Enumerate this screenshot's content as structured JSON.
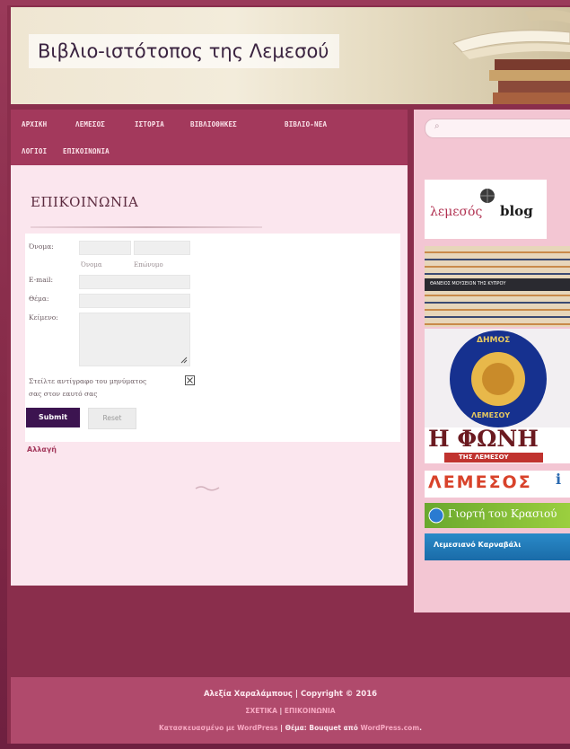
{
  "site": {
    "title": "Βιβλιο-ιστότοπος της Λεμεσού"
  },
  "nav": {
    "items": [
      "ΑΡΧΙΚΗ",
      "ΛΕΜΕΣΟΣ",
      "ΙΣΤΟΡΙΑ",
      "ΒΙΒΛΙΟΘΗΚΕΣ",
      "ΒΙΒΛΙΟ-ΝΕΑ",
      "ΛΟΓΙΟΙ",
      "ΕΠΙΚΟΙΝΩΝΙΑ"
    ]
  },
  "page": {
    "title": "ΕΠΙΚΟΙΝΩΝΙΑ"
  },
  "form": {
    "name_label": "Όνομα:",
    "first_sub": "Όνομα",
    "last_sub": "Επώνυμο",
    "email_label": "E-mail:",
    "subject_label": "Θέμα:",
    "message_label": "Κείμενο:",
    "copy_label_line1": "Στείλτε αντίγραφο του μηνύματος",
    "copy_label_line2": "σας στον εαυτό σας",
    "submit_label": "Submit",
    "reset_label": "Reset",
    "change_link": "Αλλαγή"
  },
  "sidebar": {
    "search_placeholder": "",
    "ads": [
      {
        "text": "λεμεσός",
        "text2": "blog"
      },
      {
        "text": "ΘΑΝΕΙΟΣ ΜΟΥΣΕΙΟΝ ΤΗΣ ΚΥΠΡΟΥ"
      },
      {
        "text_top": "ΔΗΜΟΣ",
        "text_bottom": "ΛΕΜΕΣΟΥ"
      },
      {
        "text": "Η ΦΩΝΗ",
        "sub": "ΤΗΣ ΛΕΜΕΣΟΥ"
      },
      {
        "text": "ΛΕΜΕΣΟΣ",
        "suffix": "i"
      },
      {
        "text": "Γιορτή του Κρασιού"
      },
      {
        "text": "Λεμεσιανό Καρναβάλι"
      }
    ]
  },
  "footer": {
    "line1": "Αλεξία Χαραλάμπους | Copyright © 2016",
    "line2_a": "ΣΧΕΤΙΚΑ",
    "line2_sep": " | ",
    "line2_b": "ΕΠΙΚΟΙΝΩΝΙΑ",
    "line3_a": "Κατασκευασμένο με WordPress",
    "line3_b": " | Θέμα: Bouquet από ",
    "line3_c": "WordPress.com",
    "line3_d": "."
  },
  "colors": {
    "accent": "#a3395c",
    "submit": "#3c1450",
    "content_bg": "#fbe6ee",
    "sidebar_bg": "#f3c6d3"
  }
}
